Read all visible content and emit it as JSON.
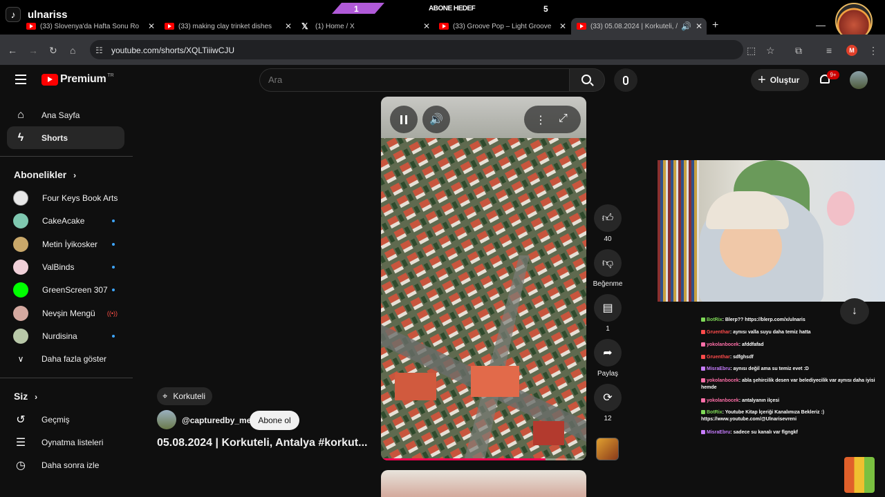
{
  "stream": {
    "tiktok_name": "ulnariss",
    "goal_count": "1",
    "goal_label": "ABONE HEDEF",
    "goal_target": "5"
  },
  "browser": {
    "tabs": [
      {
        "title": "(33) Slovenya'da Hafta Sonu Ro",
        "icon": "youtube-icon"
      },
      {
        "title": "(33) making clay trinket dishes",
        "icon": "youtube-icon"
      },
      {
        "title": "(1) Home / X",
        "icon": "x-icon"
      },
      {
        "title": "(33) Groove Pop – Light Groove",
        "icon": "youtube-icon"
      },
      {
        "title": "(33) 05.08.2024 | Korkuteli, /",
        "icon": "youtube-icon",
        "active": true
      }
    ],
    "url": "youtube.com/shorts/XQLTiiiwCJU",
    "profile_initial": "M"
  },
  "youtube": {
    "logo_text": "Premium",
    "region": "TR",
    "search_placeholder": "Ara",
    "create_label": "Oluştur",
    "notif_count": "9+",
    "nav": [
      {
        "label": "Ana Sayfa",
        "icon": "home-icon"
      },
      {
        "label": "Shorts",
        "icon": "shorts-icon",
        "active": true
      }
    ],
    "subs_title": "Abonelikler",
    "subscriptions": [
      {
        "name": "Four Keys Book Arts",
        "color": "#e8e8e8",
        "dot": false
      },
      {
        "name": "CakeAcake",
        "color": "#7fc8b0",
        "dot": true
      },
      {
        "name": "Metin İyikosker",
        "color": "#c9a86a",
        "dot": true
      },
      {
        "name": "ValBinds",
        "color": "#f0d0d8",
        "dot": true
      },
      {
        "name": "GreenScreen 307",
        "color": "#00ff00",
        "dot": true
      },
      {
        "name": "Nevşin Mengü",
        "color": "#d4a9a0",
        "live": true
      },
      {
        "name": "Nurdisina",
        "color": "#b8c8a8",
        "dot": true
      }
    ],
    "show_more": "Daha fazla göster",
    "you_title": "Siz",
    "you_items": [
      {
        "label": "Geçmiş",
        "icon": "history-icon"
      },
      {
        "label": "Oynatma listeleri",
        "icon": "playlist-icon"
      },
      {
        "label": "Daha sonra izle",
        "icon": "clock-icon"
      }
    ],
    "short": {
      "location": "Korkuteli",
      "channel": "@capturedby_me",
      "subscribe": "Abone ol",
      "title": "05.08.2024 | Korkuteli, Antalya #korkut...",
      "like_count": "40",
      "dislike_label": "Beğenme",
      "comment_count": "1",
      "share_label": "Paylaş",
      "remix_count": "12"
    }
  },
  "chat": [
    {
      "user": "BotRix",
      "user_color": "#7ed957",
      "text": "Blerp?? https://blerp.com/x/ulnaris"
    },
    {
      "user": "Gruenthar",
      "user_color": "#ff4b4b",
      "text": "aynısı valla suyu daha temiz hatta"
    },
    {
      "user": "yokolanbocek",
      "user_color": "#ff6fa8",
      "text": "afddfafad"
    },
    {
      "user": "Gruenthar",
      "user_color": "#ff4b4b",
      "text": "sdfghsdf"
    },
    {
      "user": "MisraEbru",
      "user_color": "#c77dff",
      "text": "aynısı değil ama su temiz evet :D"
    },
    {
      "user": "yokolanbocek",
      "user_color": "#ff6fa8",
      "text": "abla şehircilik desen var belediyecilik var aynısı daha iyisi hemde"
    },
    {
      "user": "yokolanbocek",
      "user_color": "#ff6fa8",
      "text": "antalyanın ilçesi"
    },
    {
      "user": "BotRix",
      "user_color": "#7ed957",
      "text": "Youtube Kitap İçeriği Kanalımıza Bekleriz :) https://www.youtube.com/@Ulnarisevreni"
    },
    {
      "user": "MisraEbru",
      "user_color": "#c77dff",
      "text": "sadece su kanalı var flgngkf"
    }
  ]
}
